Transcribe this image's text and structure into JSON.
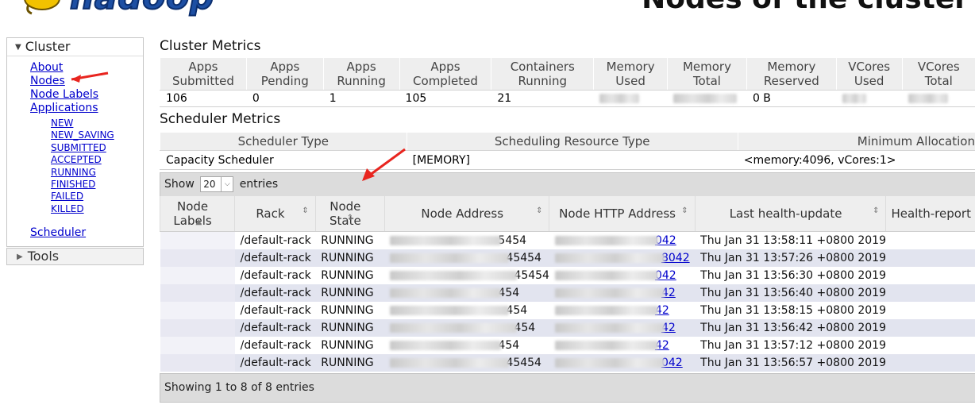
{
  "header": {
    "logo_text": "hadoop",
    "page_title": "Nodes of the cluster"
  },
  "nav": {
    "cluster_label": "Cluster",
    "items": {
      "about": "About",
      "nodes": "Nodes",
      "node_labels": "Node Labels",
      "applications": "Applications",
      "scheduler": "Scheduler"
    },
    "app_states": [
      "NEW",
      "NEW_SAVING",
      "SUBMITTED",
      "ACCEPTED",
      "RUNNING",
      "FINISHED",
      "FAILED",
      "KILLED"
    ],
    "tools_label": "Tools"
  },
  "cluster_metrics": {
    "title": "Cluster Metrics",
    "headers": [
      [
        "Apps",
        "Submitted"
      ],
      [
        "Apps",
        "Pending"
      ],
      [
        "Apps",
        "Running"
      ],
      [
        "Apps",
        "Completed"
      ],
      [
        "Containers",
        "Running"
      ],
      [
        "Memory",
        "Used"
      ],
      [
        "Memory",
        "Total"
      ],
      [
        "Memory",
        "Reserved"
      ],
      [
        "VCores",
        "Used"
      ],
      [
        "VCores",
        "Total"
      ]
    ],
    "values": [
      "106",
      "0",
      "1",
      "105",
      "21",
      "",
      "",
      "0 B",
      "",
      ""
    ]
  },
  "scheduler_metrics": {
    "title": "Scheduler Metrics",
    "headers": [
      "Scheduler Type",
      "Scheduling Resource Type",
      "Minimum Allocation"
    ],
    "values": [
      "Capacity Scheduler",
      "[MEMORY]",
      "<memory:4096, vCores:1>"
    ]
  },
  "nodes": {
    "show_label": "Show",
    "page_size": "20",
    "entries_label": "entries",
    "columns": [
      "Node Labels",
      "Rack",
      "Node State",
      "Node Address",
      "Node HTTP Address",
      "Last health-update",
      "Health-report"
    ],
    "rows": [
      {
        "labels": "",
        "rack": "/default-rack",
        "state": "RUNNING",
        "addr_suffix": "5454",
        "http_suffix": "042",
        "last_health": "Thu Jan 31 13:58:11 +0800 2019"
      },
      {
        "labels": "",
        "rack": "/default-rack",
        "state": "RUNNING",
        "addr_suffix": "45454",
        "http_suffix": "8042",
        "last_health": "Thu Jan 31 13:57:26 +0800 2019"
      },
      {
        "labels": "",
        "rack": "/default-rack",
        "state": "RUNNING",
        "addr_suffix": "45454",
        "http_suffix": "042",
        "last_health": "Thu Jan 31 13:56:30 +0800 2019"
      },
      {
        "labels": "",
        "rack": "/default-rack",
        "state": "RUNNING",
        "addr_suffix": "454",
        "http_suffix": "42",
        "last_health": "Thu Jan 31 13:56:40 +0800 2019"
      },
      {
        "labels": "",
        "rack": "/default-rack",
        "state": "RUNNING",
        "addr_suffix": "454",
        "http_suffix": "42",
        "last_health": "Thu Jan 31 13:58:15 +0800 2019"
      },
      {
        "labels": "",
        "rack": "/default-rack",
        "state": "RUNNING",
        "addr_suffix": "454",
        "http_suffix": "42",
        "last_health": "Thu Jan 31 13:56:42 +0800 2019"
      },
      {
        "labels": "",
        "rack": "/default-rack",
        "state": "RUNNING",
        "addr_suffix": "454",
        "http_suffix": "42",
        "last_health": "Thu Jan 31 13:57:12 +0800 2019"
      },
      {
        "labels": "",
        "rack": "/default-rack",
        "state": "RUNNING",
        "addr_suffix": "45454",
        "http_suffix": "042",
        "last_health": "Thu Jan 31 13:56:57 +0800 2019"
      }
    ],
    "footer": "Showing 1 to 8 of 8 entries"
  },
  "colors": {
    "link": "#0000cc",
    "arrow": "#e8251f",
    "stripe": "#e2e4ef",
    "toolbar": "#dcdcdc"
  },
  "icons": [
    "hadoop-elephant-logo",
    "caret-down-icon",
    "caret-right-icon",
    "sort-icon",
    "red-arrow-annotation"
  ]
}
